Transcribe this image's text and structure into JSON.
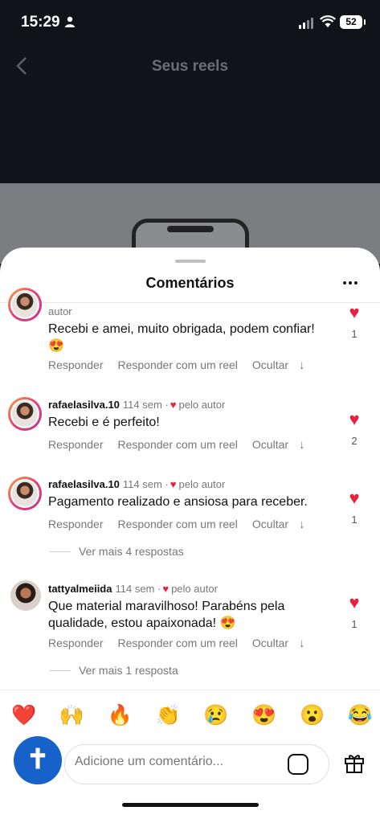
{
  "status_bar": {
    "time": "15:29",
    "battery": "52"
  },
  "header": {
    "title": "Seus reels"
  },
  "sheet": {
    "title": "Comentários"
  },
  "comments": [
    {
      "username": "",
      "time": "",
      "author_label": "autor",
      "text_line1": "Recebi e amei, muito obrigada, podem confiar!",
      "text_line2": "😍",
      "likes": "1"
    },
    {
      "username": "rafaelasilva.10",
      "time": "114 sem",
      "author_label": "pelo autor",
      "text_line1": "Recebi e é perfeito!",
      "text_line2": "",
      "likes": "2"
    },
    {
      "username": "rafaelasilva.10",
      "time": "114 sem",
      "author_label": "pelo autor",
      "text_line1": "Pagamento realizado e ansiosa para receber.",
      "text_line2": "",
      "likes": "1",
      "more_replies": "Ver mais 4 respostas"
    },
    {
      "username": "tattyalmeiida",
      "time": "114 sem",
      "author_label": "pelo autor",
      "text_line1": "Que material maravilhoso! Parabéns pela",
      "text_line2": "qualidade, estou apaixonada! 😍",
      "likes": "1",
      "more_replies": "Ver mais 1 resposta"
    }
  ],
  "actions": {
    "reply": "Responder",
    "reply_reel": "Responder com um reel",
    "hide": "Ocultar",
    "down": "↓"
  },
  "heart_glyph": "♥",
  "dot_sep": "·",
  "emojis": [
    "❤️",
    "🙌",
    "🔥",
    "👏",
    "😢",
    "😍",
    "😮",
    "😂"
  ],
  "composer": {
    "placeholder": "Adicione um comentário..."
  },
  "icons": [
    "back-icon",
    "more-icon",
    "heart-icon",
    "sticker-icon",
    "gift-icon"
  ],
  "colors": {
    "like_red": "#e5213e",
    "sheet_bg": "#ffffff",
    "backdrop": "#101318"
  }
}
